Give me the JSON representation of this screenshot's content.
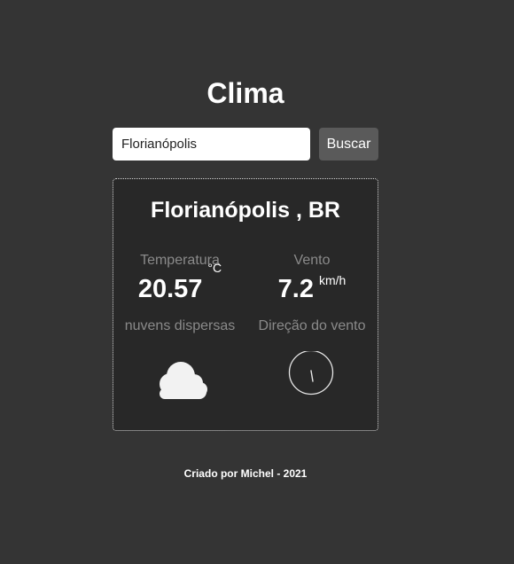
{
  "app": {
    "title": "Clima"
  },
  "search": {
    "value": "Florianópolis",
    "button_label": "Buscar"
  },
  "weather": {
    "location": "Florianópolis , BR",
    "temperature": {
      "label": "Temperatura",
      "value": "20.57",
      "unit": "°C"
    },
    "description": "nuvens dispersas",
    "condition_icon": "cloud-icon",
    "wind": {
      "label": "Vento",
      "value": "7.2",
      "unit": "km/h",
      "direction_label": "Direção do vento",
      "direction_icon": "wind-compass-icon"
    }
  },
  "footer": {
    "text": "Criado por Michel - 2021"
  }
}
